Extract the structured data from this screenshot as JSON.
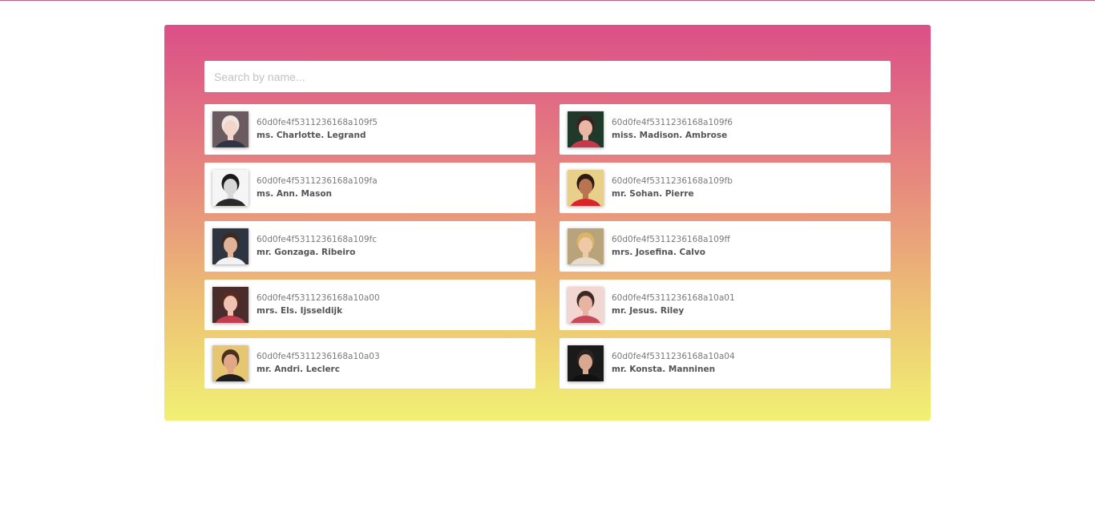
{
  "search": {
    "placeholder": "Search by name..."
  },
  "users": [
    {
      "id": "60d0fe4f5311236168a109f5",
      "name": "ms. Charlotte. Legrand",
      "bg": "#6b5a60",
      "skin": "#f2d6cc",
      "hair": "#efe7dc",
      "shirt": "#2e3444"
    },
    {
      "id": "60d0fe4f5311236168a109f6",
      "name": "miss. Madison. Ambrose",
      "bg": "#1f3a2a",
      "skin": "#e9b8a4",
      "hair": "#3a2020",
      "shirt": "#c8384a"
    },
    {
      "id": "60d0fe4f5311236168a109fa",
      "name": "ms. Ann. Mason",
      "bg": "#f5f5f5",
      "skin": "#d8d8d8",
      "hair": "#1a1a1a",
      "shirt": "#2a2a2a"
    },
    {
      "id": "60d0fe4f5311236168a109fb",
      "name": "mr. Sohan. Pierre",
      "bg": "#e8cf8a",
      "skin": "#b97550",
      "hair": "#2a1a12",
      "shirt": "#d8242a"
    },
    {
      "id": "60d0fe4f5311236168a109fc",
      "name": "mr. Gonzaga. Ribeiro",
      "bg": "#2e3540",
      "skin": "#e2b398",
      "hair": "#3a2c22",
      "shirt": "#f2f2f2"
    },
    {
      "id": "60d0fe4f5311236168a109ff",
      "name": "mrs. Josefina. Calvo",
      "bg": "#b8a37a",
      "skin": "#efc8a8",
      "hair": "#d9b56a",
      "shirt": "#e8dcc8"
    },
    {
      "id": "60d0fe4f5311236168a10a00",
      "name": "mrs. Els. Ijsseldijk",
      "bg": "#4a2c2c",
      "skin": "#f0c2b0",
      "hair": "#5a2a1e",
      "shirt": "#c43c50"
    },
    {
      "id": "60d0fe4f5311236168a10a01",
      "name": "mr. Jesus. Riley",
      "bg": "#f1d6d2",
      "skin": "#e8b4a2",
      "hair": "#3c2a22",
      "shirt": "#c84a5a"
    },
    {
      "id": "60d0fe4f5311236168a10a03",
      "name": "mr. Andri. Leclerc",
      "bg": "#e6c670",
      "skin": "#e0a887",
      "hair": "#4a3020",
      "shirt": "#1e1e1e"
    },
    {
      "id": "60d0fe4f5311236168a10a04",
      "name": "mr. Konsta. Manninen",
      "bg": "#1a1a1a",
      "skin": "#d8a890",
      "hair": "#2a2420",
      "shirt": "#101010"
    }
  ]
}
